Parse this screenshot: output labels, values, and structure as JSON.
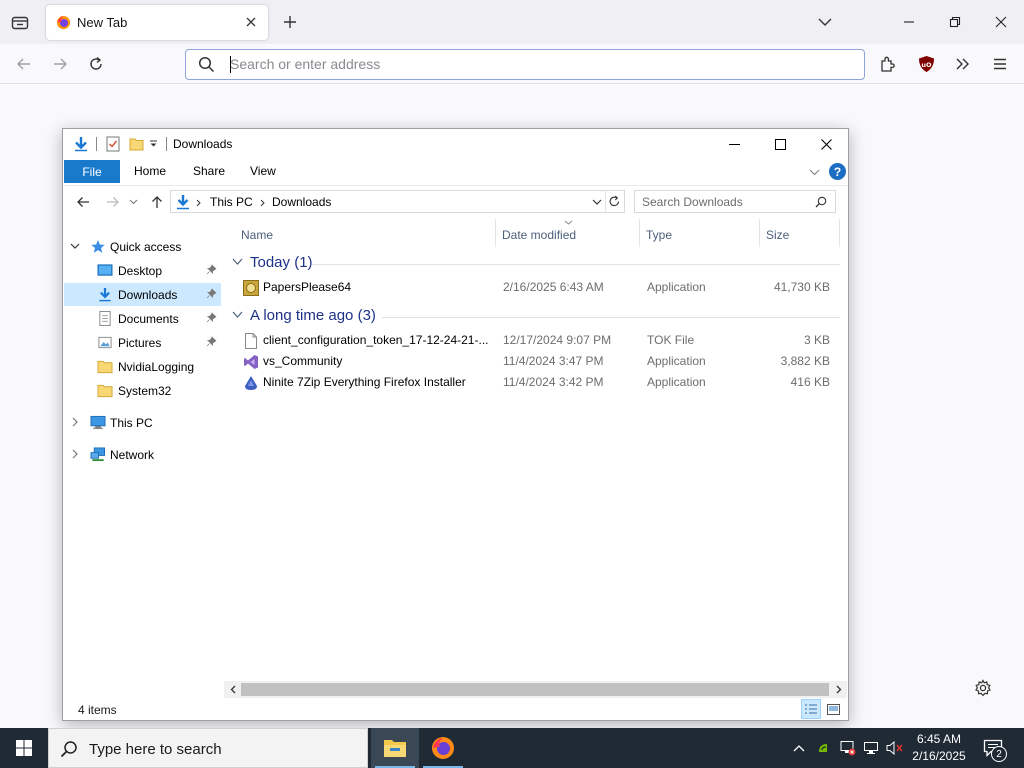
{
  "browser": {
    "tab": {
      "title": "New Tab"
    },
    "urlbar": {
      "placeholder": "Search or enter address",
      "value": ""
    }
  },
  "explorer": {
    "title": "Downloads",
    "ribbon": {
      "file": "File",
      "tabs": [
        "Home",
        "Share",
        "View"
      ]
    },
    "address": {
      "segments": [
        "This PC",
        "Downloads"
      ]
    },
    "search": {
      "placeholder": "Search Downloads"
    },
    "nav": {
      "quick_access": "Quick access",
      "items": [
        "Desktop",
        "Downloads",
        "Documents",
        "Pictures",
        "NvidiaLogging",
        "System32"
      ],
      "this_pc": "This PC",
      "network": "Network"
    },
    "columns": [
      "Name",
      "Date modified",
      "Type",
      "Size"
    ],
    "groups": [
      {
        "title": "Today (1)",
        "files": [
          {
            "name": "PapersPlease64",
            "date": "2/16/2025 6:43 AM",
            "type": "Application",
            "size": "41,730 KB",
            "icon": "papers-please-icon"
          }
        ]
      },
      {
        "title": "A long time ago (3)",
        "files": [
          {
            "name": "client_configuration_token_17-12-24-21-...",
            "date": "12/17/2024 9:07 PM",
            "type": "TOK File",
            "size": "3 KB",
            "icon": "blank-file-icon"
          },
          {
            "name": "vs_Community",
            "date": "11/4/2024 3:47 PM",
            "type": "Application",
            "size": "3,882 KB",
            "icon": "visual-studio-icon"
          },
          {
            "name": "Ninite 7Zip Everything Firefox Installer",
            "date": "11/4/2024 3:42 PM",
            "type": "Application",
            "size": "416 KB",
            "icon": "ninite-icon"
          }
        ]
      }
    ],
    "status": "4 items"
  },
  "taskbar": {
    "search_placeholder": "Type here to search",
    "time": "6:45 AM",
    "date": "2/16/2025",
    "notification_count": "2"
  },
  "colors": {
    "explorer_accent": "#1979ca",
    "selection": "#cce8ff",
    "group_title": "#1e3287",
    "taskbar_bg": "#1f2a35"
  }
}
